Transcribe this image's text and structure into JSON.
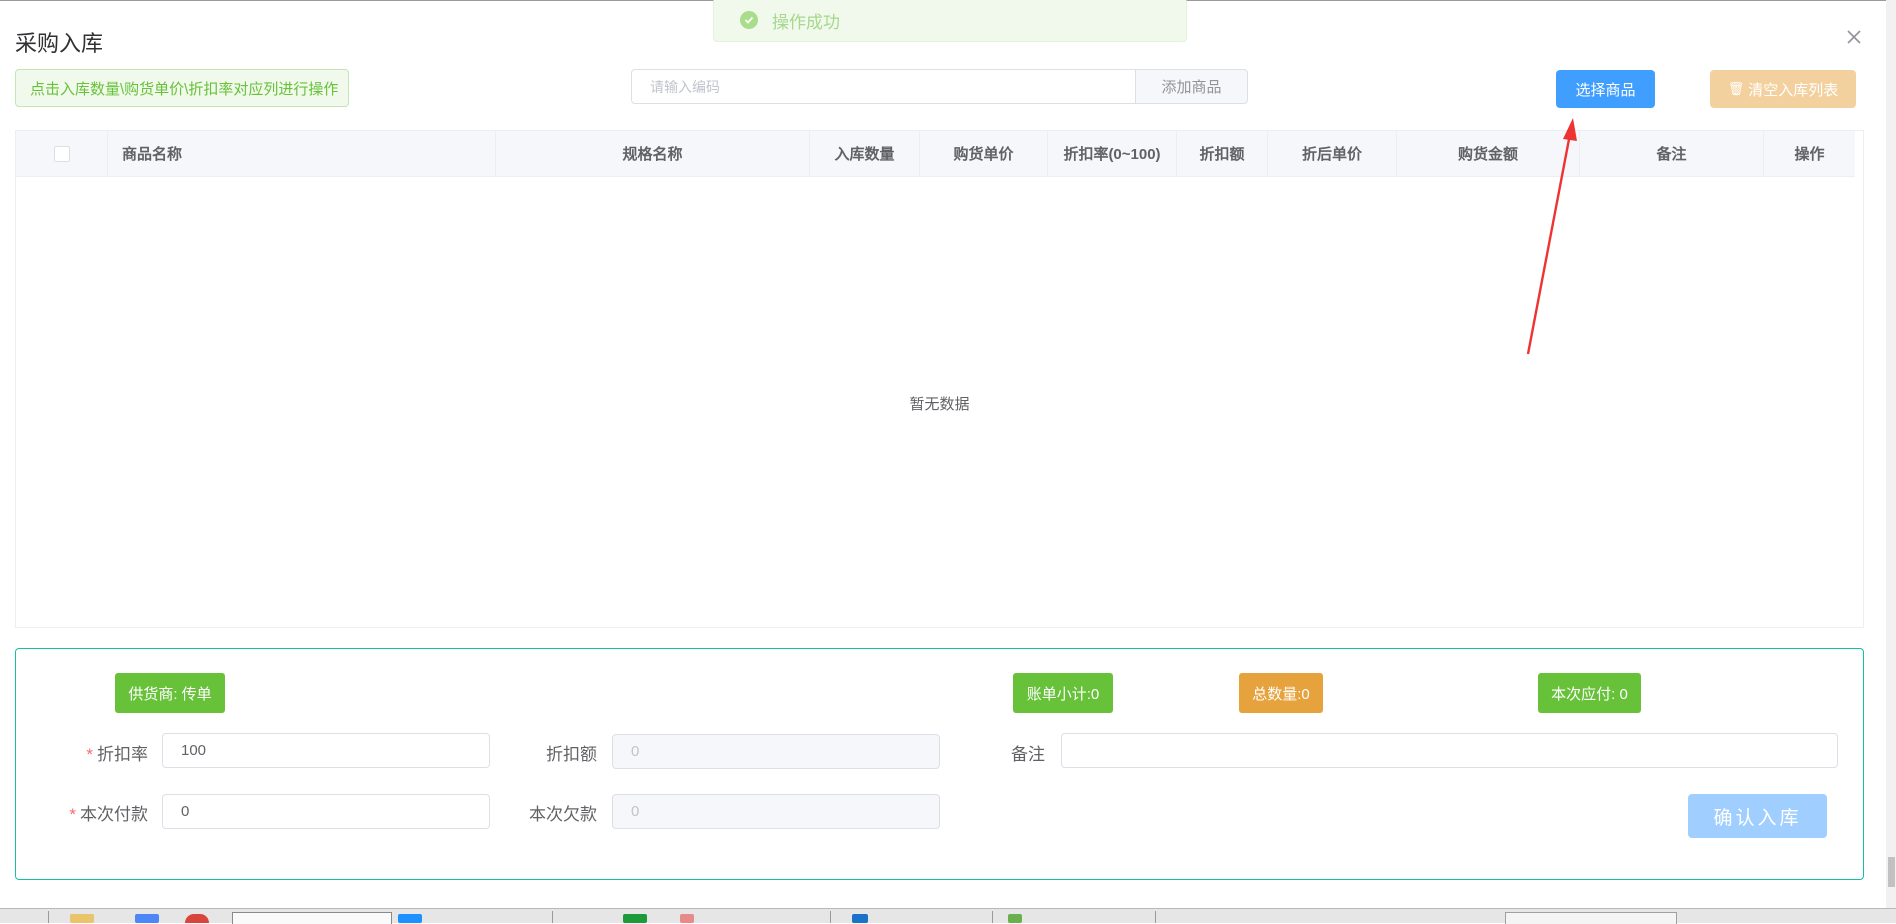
{
  "dialog": {
    "title": "采购入库"
  },
  "toast": {
    "message": "操作成功"
  },
  "toolbar": {
    "tip": "点击入库数量\\购货单价\\折扣率对应列进行操作",
    "code_placeholder": "请输入编码",
    "add_label": "添加商品",
    "select_label": "选择商品",
    "clear_label": "清空入库列表"
  },
  "table": {
    "columns": [
      "商品名称",
      "规格名称",
      "入库数量",
      "购货单价",
      "折扣率(0~100)",
      "折扣额",
      "折后单价",
      "购货金额",
      "备注",
      "操作"
    ],
    "empty_text": "暂无数据"
  },
  "summary": {
    "supplier": "供货商: 传单",
    "bill_subtotal": "账单小计:0",
    "total_qty": "总数量:0",
    "payable": "本次应付: 0"
  },
  "form": {
    "discount_rate_label": "折扣率",
    "discount_rate_value": "100",
    "discount_amount_label": "折扣额",
    "discount_amount_value": "0",
    "remark_label": "备注",
    "remark_value": "",
    "payment_label": "本次付款",
    "payment_value": "0",
    "arrears_label": "本次欠款",
    "arrears_value": "0",
    "confirm_label": "确认入库"
  },
  "colors": {
    "primary": "#409eff",
    "success": "#67c23a",
    "warning": "#e6a23c",
    "annotation_arrow": "#ee3333"
  }
}
